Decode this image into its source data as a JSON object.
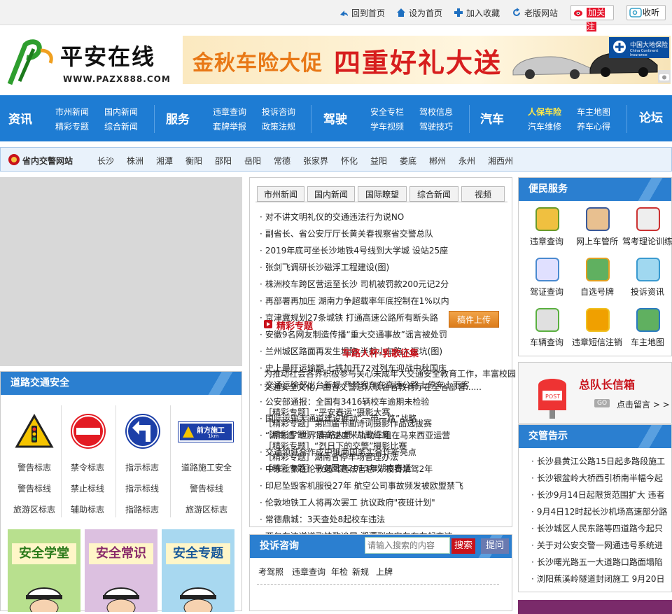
{
  "topbar": {
    "links": [
      "回到首页",
      "设为首页",
      "加入收藏",
      "老版网站"
    ],
    "weibo_label": "加关注",
    "listen_label": "收听"
  },
  "logo": {
    "name": "平安在线",
    "url": "WWW.PAZX888.COM"
  },
  "banner": {
    "text1": "金秋车险大促",
    "text2": "四重好礼大送",
    "brand": "中国大地保险",
    "brand_en": "China Continent Insurance"
  },
  "nav": {
    "cats": [
      "资讯",
      "服务",
      "驾驶",
      "汽车",
      "论坛"
    ],
    "links": [
      [
        "市州新闻",
        "精彩专题"
      ],
      [
        "国内新闻",
        "综合新闻"
      ],
      [
        "违章查询",
        "套牌举报"
      ],
      [
        "投诉咨询",
        "政策法规"
      ],
      [
        "安全专栏",
        "学车视频"
      ],
      [
        "驾校信息",
        "驾驶技巧"
      ],
      [
        "人保车险",
        "汽车维修"
      ],
      [
        "车主地图",
        "养车心得"
      ]
    ]
  },
  "cities": {
    "label": "省内交警网站",
    "items": [
      "长沙",
      "株洲",
      "湘潭",
      "衡阳",
      "邵阳",
      "岳阳",
      "常德",
      "张家界",
      "怀化",
      "益阳",
      "娄底",
      "郴州",
      "永州",
      "湘西州"
    ]
  },
  "road_safety": {
    "title": "道路交通安全",
    "signs": [
      [
        "警告标志",
        "警告标线",
        "旅游区标志"
      ],
      [
        "禁令标志",
        "禁止标线",
        "辅助标志"
      ],
      [
        "指示标志",
        "指示标线",
        "指路标志"
      ],
      [
        "道路施工安全",
        "警告标线",
        "旅游区标志"
      ]
    ],
    "construction_sign": "前方施工",
    "construction_sub": "1km",
    "cards": [
      "安全学堂",
      "安全常识",
      "安全专题"
    ]
  },
  "news": {
    "tabs": [
      "市州新闻",
      "国内新闻",
      "国际瞭望",
      "综合新闻",
      "视频"
    ],
    "items": [
      "对不讲文明礼仪的交通违法行为说NO",
      "副省长、省公安厅厅长黄关春视察省交警总队",
      "2019年底可坐长沙地铁4号线到大学城 设站25座",
      "张剑飞调研长沙磁浮工程建设(图)",
      "株洲校车跨区营运至长沙 司机被罚款200元记2分",
      "再部署再加压 湖南力争超载率年底控制在1%以内",
      "京津冀规划27条城铁 打通高速公路所有断头路",
      "安徽9名网友制造传播“重大交通事故”谣言被处罚",
      "兰州城区路面再发生塌陷 半截小车陷入深坑(图)",
      "史上最旺运输期 七铁加开72对列车迎战中秋国庆",
      "交通运输部出台新规 严禁客车在高速公路上停车上下客",
      "公安部通报：全国有3416辆校车逾期未检验",
      "国际运输大通道建设推动“一带一路”战略",
      "“湖南造”世界最高速度米轨动车组在马来西亚运营",
      "交通领域合作成中俄两国务实合作新亮点",
      "中东土豪在伦敦遇驾违法官感叹 被罚禁驾2年",
      "印尼坠毁客机服役27年 航空公司事故频发被欧盟禁飞",
      "伦敦地铁工人将再次罢工 抗议政府\"夜班计划\"",
      "常德鼎城：3天查处8起校车违法",
      "两包车边逆道飞快致追尾 湘潭到宝安车在左起高速"
    ],
    "overlay_title": "精彩专题",
    "overlay_red": "车路人杯·乳歌征集",
    "overlay_line1": "为推动社会各界积极参与关心未成年人交通安全教育工作，丰富校园",
    "overlay_line2": "交通安全文化，由省交警总队联合省教育厅在全省部署......",
    "upload_btn": "稿件上传",
    "specials": [
      "［精彩专题］“平安春运”摄影大赛",
      "［精彩专题］第四届书画诗词摄影作品选拔赛",
      "［精彩专题］“车路人杯”儿歌征集",
      "［精彩专题］“烈日下的交警”摄影比赛",
      "［精彩专题］湖南省停车场管理办法",
      "［精彩专题］平安回家2013年湖南春运"
    ]
  },
  "complain": {
    "title": "投诉咨询",
    "search_placeholder": "请输入搜索的内容",
    "search_btn": "搜索",
    "ask_btn": "提问",
    "tags": [
      "考驾照",
      "违章查询",
      "年检",
      "新规",
      "上牌"
    ]
  },
  "services": {
    "title": "便民服务",
    "items": [
      "违章查询",
      "网上车管所",
      "驾考理论训练",
      "驾证查询",
      "自选号牌",
      "投诉资讯",
      "车辆查询",
      "违章短信注销",
      "车主地图"
    ]
  },
  "mailbox": {
    "title": "总队长信箱",
    "go_label": "GO",
    "sub": "点击留言 > >",
    "post": "POST"
  },
  "notices": {
    "title": "交管告示",
    "items": [
      "长沙县黄江公路15日起多路段施工",
      "长沙银盆岭大桥西引桥南半幅今起",
      "长沙9月14日起限货范围扩大 违者",
      "9月4日12时起长沙机场高速部分路",
      "长沙城区人民东路等四道路今起只",
      "关于对公安交警一网通违号系统进",
      "长沙曙光路五一大道路口路面塌陷",
      "浏阳蕉溪岭隧道封闭施工 9月20日"
    ]
  },
  "colors": {
    "accent": "#2b7fd0",
    "nav": "#1e7cd3",
    "red": "#c8121b"
  }
}
